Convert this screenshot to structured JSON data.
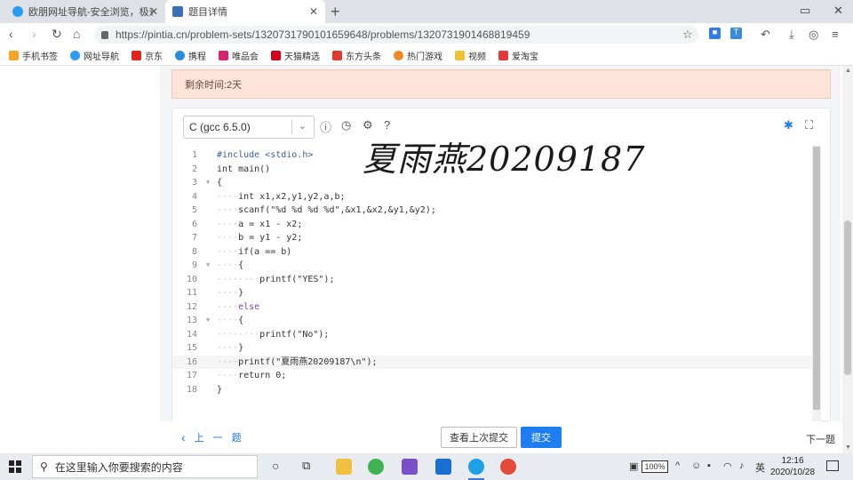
{
  "browser": {
    "tabs": [
      {
        "title": "欧朋网址导航-安全浏览，极速体",
        "icon_color": "#2b9cf2"
      },
      {
        "title": "题目详情",
        "icon_color": "#3a6fb5"
      }
    ],
    "url": "https://pintia.cn/problem-sets/1320731790101659648/problems/1320731901468819459",
    "bookmarks": [
      {
        "label": "手机书签",
        "icon_color": "#f5a623"
      },
      {
        "label": "网址导航",
        "icon_color": "#2b9cf2"
      },
      {
        "label": "京东",
        "icon_color": "#e1251b"
      },
      {
        "label": "携程",
        "icon_color": "#2a8be0"
      },
      {
        "label": "唯品会",
        "icon_color": "#d6246e"
      },
      {
        "label": "天猫精选",
        "icon_color": "#d4001a"
      },
      {
        "label": "东方头条",
        "icon_color": "#e03a2f"
      },
      {
        "label": "热门游戏",
        "icon_color": "#f08a24"
      },
      {
        "label": "视频",
        "icon_color": "#f2c230"
      },
      {
        "label": "爱淘宝",
        "icon_color": "#e4393c"
      }
    ]
  },
  "exam": {
    "time_remaining": "剩余时间:2天",
    "language": "C (gcc 6.5.0)",
    "handwriting": "夏雨燕20209187",
    "prev_label": "上一题",
    "view_last_label": "查看上次提交",
    "submit_label": "提交",
    "next_label": "下一题"
  },
  "code": {
    "lines": [
      {
        "n": "1",
        "fold": "",
        "indent": "",
        "text": "#include <stdio.h>",
        "cls": "pp"
      },
      {
        "n": "2",
        "fold": "",
        "indent": "",
        "text": "int main()",
        "cls": ""
      },
      {
        "n": "3",
        "fold": "▼",
        "indent": "",
        "text": "{",
        "cls": ""
      },
      {
        "n": "4",
        "fold": "",
        "indent": "····",
        "text": "int x1,x2,y1,y2,a,b;",
        "cls": ""
      },
      {
        "n": "5",
        "fold": "",
        "indent": "····",
        "text": "scanf(\"%d %d %d %d\",&x1,&x2,&y1,&y2);",
        "cls": ""
      },
      {
        "n": "6",
        "fold": "",
        "indent": "····",
        "text": "a = x1 - x2;",
        "cls": ""
      },
      {
        "n": "7",
        "fold": "",
        "indent": "····",
        "text": "b = y1 - y2;",
        "cls": ""
      },
      {
        "n": "8",
        "fold": "",
        "indent": "····",
        "text": "if(a == b)",
        "cls": ""
      },
      {
        "n": "9",
        "fold": "▼",
        "indent": "····",
        "text": "{",
        "cls": ""
      },
      {
        "n": "10",
        "fold": "",
        "indent": "········",
        "text": "printf(\"YES\");",
        "cls": ""
      },
      {
        "n": "11",
        "fold": "",
        "indent": "····",
        "text": "}",
        "cls": ""
      },
      {
        "n": "12",
        "fold": "",
        "indent": "····",
        "text": "else",
        "cls": "kw"
      },
      {
        "n": "13",
        "fold": "▼",
        "indent": "····",
        "text": "{",
        "cls": ""
      },
      {
        "n": "14",
        "fold": "",
        "indent": "········",
        "text": "printf(\"No\");",
        "cls": ""
      },
      {
        "n": "15",
        "fold": "",
        "indent": "····",
        "text": "}",
        "cls": ""
      },
      {
        "n": "16",
        "fold": "",
        "indent": "····",
        "text": "printf(\"夏雨燕20209187\\n\");",
        "cls": "",
        "active": true
      },
      {
        "n": "17",
        "fold": "",
        "indent": "····",
        "text": "return 0;",
        "cls": ""
      },
      {
        "n": "18",
        "fold": "",
        "indent": "",
        "text": "}",
        "cls": ""
      }
    ]
  },
  "taskbar": {
    "search_placeholder": "在这里输入你要搜索的内容",
    "battery": "100%",
    "ime": "英",
    "time": "12:16",
    "date": "2020/10/28"
  }
}
